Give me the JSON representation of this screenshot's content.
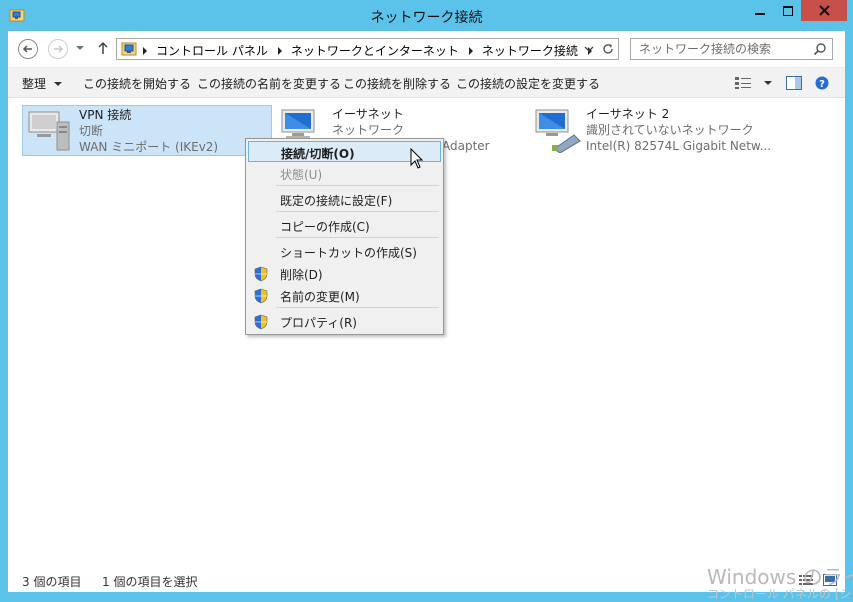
{
  "window": {
    "title": "ネットワーク接続"
  },
  "breadcrumbs": [
    "コントロール パネル",
    "ネットワークとインターネット",
    "ネットワーク接続"
  ],
  "search": {
    "placeholder": "ネットワーク接続の検索"
  },
  "toolbar": {
    "organize": "整理",
    "start_connection": "この接続を開始する",
    "rename_connection": "この接続の名前を変更する",
    "delete_connection": "この接続を削除する",
    "change_settings": "この接続の設定を変更する"
  },
  "items": [
    {
      "name": "VPN 接続",
      "status": "切断",
      "device": "WAN ミニポート (IKEv2)",
      "icon": "vpn-computer-icon",
      "selected": true
    },
    {
      "name": "イーサネット",
      "status": "ネットワーク",
      "device": "Adapter",
      "icon": "ethernet-adapter-icon",
      "selected": false
    },
    {
      "name": "イーサネット 2",
      "status": "識別されていないネットワーク",
      "device": "Intel(R) 82574L Gigabit Netw...",
      "icon": "ethernet-adapter-icon",
      "selected": false
    }
  ],
  "context_menu": {
    "connect_disconnect": "接続/切断(O)",
    "status": "状態(U)",
    "set_default": "既定の接続に設定(F)",
    "create_copy": "コピーの作成(C)",
    "create_shortcut": "ショートカットの作成(S)",
    "delete": "削除(D)",
    "rename": "名前の変更(M)",
    "properties": "プロパティ(R)"
  },
  "status_bar": {
    "item_count": "3 個の項目",
    "selected_count": "1 個の項目を選択"
  },
  "watermark": {
    "line1": "Windows のライ",
    "line2": "コントロール パネルの [シ"
  },
  "colors": {
    "titlebar": "#5bc3ea",
    "close_button": "#c7514a",
    "selection": "#cce4f7",
    "menu_highlight": "#dbecf8"
  }
}
